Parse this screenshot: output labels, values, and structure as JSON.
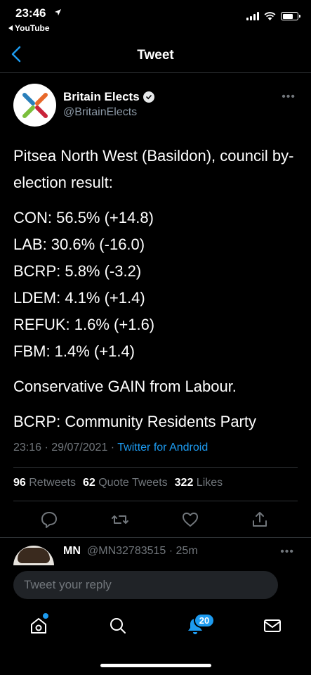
{
  "status_bar": {
    "time": "23:46",
    "back_app": "YouTube"
  },
  "nav": {
    "title": "Tweet"
  },
  "author": {
    "name": "Britain Elects",
    "handle": "@BritainElects",
    "verified": true
  },
  "tweet": {
    "lines": [
      "Pitsea North West (Basildon), council by-election result:",
      "CON: 56.5% (+14.8)",
      "LAB: 30.6% (-16.0)",
      "BCRP: 5.8% (-3.2)",
      "LDEM: 4.1% (+1.4)",
      "REFUK: 1.6% (+1.6)",
      "FBM: 1.4% (+1.4)",
      "Conservative GAIN from Labour.",
      "BCRP: Community Residents Party"
    ],
    "timestamp": "23:16 · 29/07/2021 · ",
    "source": "Twitter for Android"
  },
  "stats": {
    "retweets_count": "96",
    "retweets_label": "Retweets",
    "quotes_count": "62",
    "quotes_label": "Quote Tweets",
    "likes_count": "322",
    "likes_label": "Likes"
  },
  "reply": {
    "name": "MN",
    "handle_time": "@MN32783515 · 25m"
  },
  "compose": {
    "placeholder": "Tweet your reply"
  },
  "tabbar": {
    "notifications_badge": "20"
  },
  "colors": {
    "accent": "#1d9bf0",
    "background": "#000000",
    "secondary_text": "#71767b"
  }
}
